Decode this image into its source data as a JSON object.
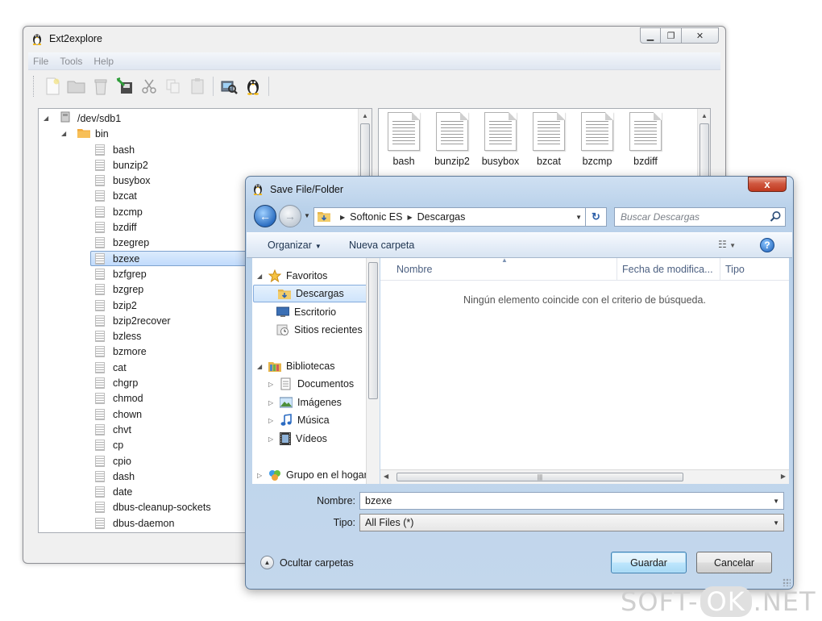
{
  "main_window": {
    "title": "Ext2explore",
    "menu": [
      "File",
      "Tools",
      "Help"
    ],
    "toolbar_icons": [
      "new-file-icon",
      "open-folder-icon",
      "trash-icon",
      "save-icon",
      "cut-icon",
      "copy-icon",
      "paste-icon",
      "disk-search-icon",
      "linux-tux-icon"
    ],
    "tree": {
      "root": "/dev/sdb1",
      "folder": "bin",
      "files": [
        "bash",
        "bunzip2",
        "busybox",
        "bzcat",
        "bzcmp",
        "bzdiff",
        "bzegrep",
        "bzexe",
        "bzfgrep",
        "bzgrep",
        "bzip2",
        "bzip2recover",
        "bzless",
        "bzmore",
        "cat",
        "chgrp",
        "chmod",
        "chown",
        "chvt",
        "cp",
        "cpio",
        "dash",
        "date",
        "dbus-cleanup-sockets",
        "dbus-daemon"
      ],
      "selected": "bzexe"
    },
    "icon_view": [
      "bash",
      "bunzip2",
      "busybox",
      "bzcat",
      "bzcmp",
      "bzdiff"
    ]
  },
  "dialog": {
    "title": "Save File/Folder",
    "close_label": "x",
    "address": {
      "segments": [
        "Softonic ES",
        "Descargas"
      ]
    },
    "search_placeholder": "Buscar Descargas",
    "organize_label": "Organizar",
    "new_folder_label": "Nueva carpeta",
    "nav": {
      "favorites": "Favoritos",
      "favorites_items": [
        "Descargas",
        "Escritorio",
        "Sitios recientes"
      ],
      "libraries": "Bibliotecas",
      "libraries_items": [
        "Documentos",
        "Imágenes",
        "Música",
        "Vídeos"
      ],
      "homegroup": "Grupo en el hogar"
    },
    "columns": [
      "Nombre",
      "Fecha de modifica...",
      "Tipo"
    ],
    "empty_message": "Ningún elemento coincide con el criterio de búsqueda.",
    "filename_label": "Nombre:",
    "filename_value": "bzexe",
    "type_label": "Tipo:",
    "type_value": "All Files (*)",
    "hide_folders_label": "Ocultar carpetas",
    "save_label": "Guardar",
    "cancel_label": "Cancelar"
  },
  "watermark": {
    "left": "SOFT-",
    "mid": "OK",
    "right": ".NET"
  }
}
